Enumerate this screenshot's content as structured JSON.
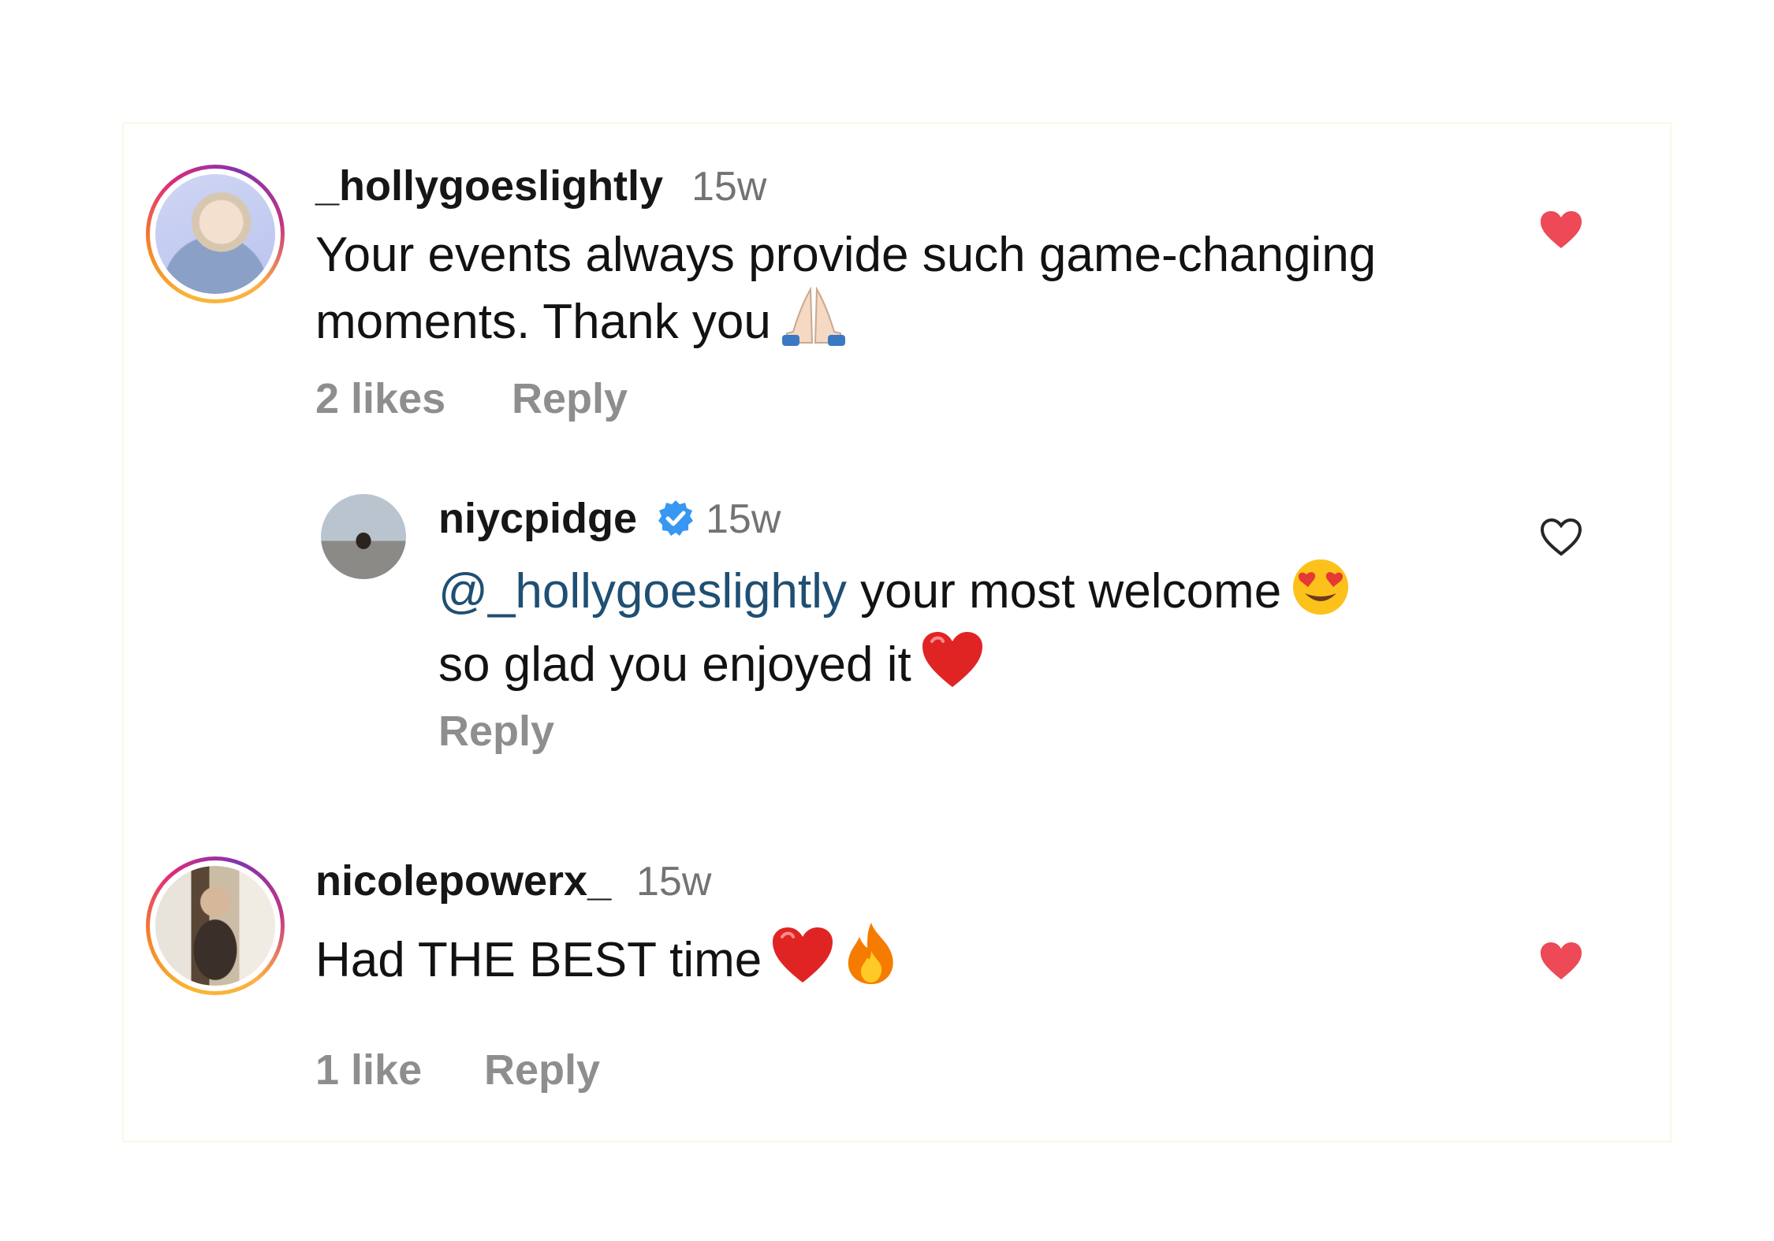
{
  "comments": [
    {
      "username": "_hollygoeslightly",
      "time": "15w",
      "text_line1": "Your events always provide such game-changing",
      "text_line2": "moments. Thank you",
      "likes": "2 likes",
      "reply": "Reply",
      "liked": true,
      "emoji": [
        "folded-hands"
      ]
    },
    {
      "username": "niycpidge",
      "verified": true,
      "time": "15w",
      "mention": "@_hollygoeslightly",
      "text_line1_rest": "your most welcome",
      "text_line2": "so glad you enjoyed it",
      "reply": "Reply",
      "liked": false,
      "emoji": [
        "heart-eyes",
        "red-heart"
      ]
    },
    {
      "username": "nicolepowerx_",
      "time": "15w",
      "text_line1": "Had THE BEST time",
      "likes": "1 like",
      "reply": "Reply",
      "liked": true,
      "emoji": [
        "red-heart",
        "fire"
      ]
    }
  ],
  "colors": {
    "like_red": "#ed4956",
    "mention_blue": "#1f4f73",
    "meta_gray": "#8e8e8e",
    "verified_blue": "#3897f0"
  }
}
